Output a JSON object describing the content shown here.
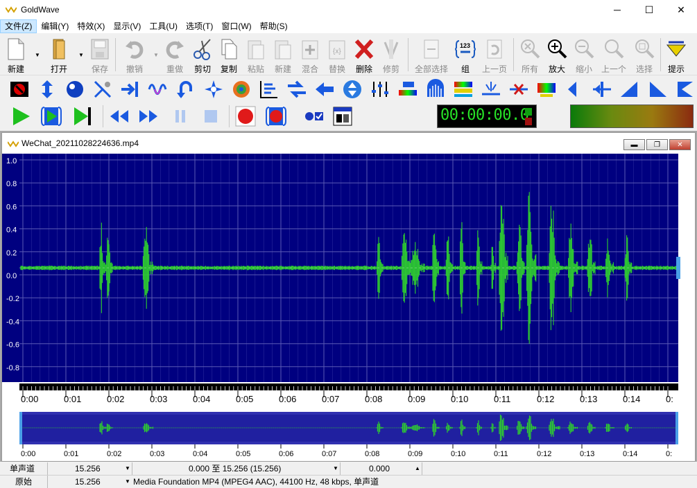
{
  "app": {
    "title": "GoldWave",
    "minimize": "─",
    "maximize": "☐",
    "close": "✕"
  },
  "menu": [
    "文件(Z)",
    "编辑(Y)",
    "特效(X)",
    "显示(V)",
    "工具(U)",
    "选项(T)",
    "窗口(W)",
    "帮助(S)"
  ],
  "toolbar": {
    "new": "新建",
    "open": "打开",
    "save": "保存",
    "undo": "撤销",
    "redo": "重做",
    "cut": "剪切",
    "copy": "复制",
    "paste": "粘贴",
    "paste_new": "新建",
    "mix": "混合",
    "replace": "替换",
    "delete": "删除",
    "trim": "修剪",
    "select_all": "全部选择",
    "group": "组",
    "prev_page": "上一页",
    "all": "所有",
    "zoom_in": "放大",
    "zoom_out": "缩小",
    "prev": "上一个",
    "select": "选择",
    "hint": "提示"
  },
  "counter": {
    "time": "00:00:00.0"
  },
  "document": {
    "title": "WeChat_20211028224636.mp4",
    "y_ticks": [
      "1.0",
      "0.8",
      "0.6",
      "0.4",
      "0.2",
      "0.0",
      "-0.2",
      "-0.4",
      "-0.6",
      "-0.8"
    ],
    "time_ticks": [
      "0:00",
      "0:01",
      "0:02",
      "0:03",
      "0:04",
      "0:05",
      "0:06",
      "0:07",
      "0:08",
      "0:09",
      "0:10",
      "0:11",
      "0:12",
      "0:13",
      "0:14",
      "0:"
    ],
    "overview_ticks": [
      "0:00",
      "0:01",
      "0:02",
      "0:03",
      "0:04",
      "0:05",
      "0:06",
      "0:07",
      "0:08",
      "0:09",
      "0:10",
      "0:11",
      "0:12",
      "0:13",
      "0:14",
      "0:"
    ]
  },
  "colors": {
    "wave": "#2fcf2f",
    "bg": "#000080",
    "grid": "#5a5ab4"
  },
  "status": {
    "row1": {
      "channel": "单声道",
      "length": "15.256",
      "selection": "0.000 至 15.256 (15.256)",
      "position": "0.000"
    },
    "row2": {
      "label": "原始",
      "length": "15.256",
      "format": "Media Foundation MP4 (MPEG4 AAC), 44100 Hz, 48 kbps, 单声道"
    }
  }
}
